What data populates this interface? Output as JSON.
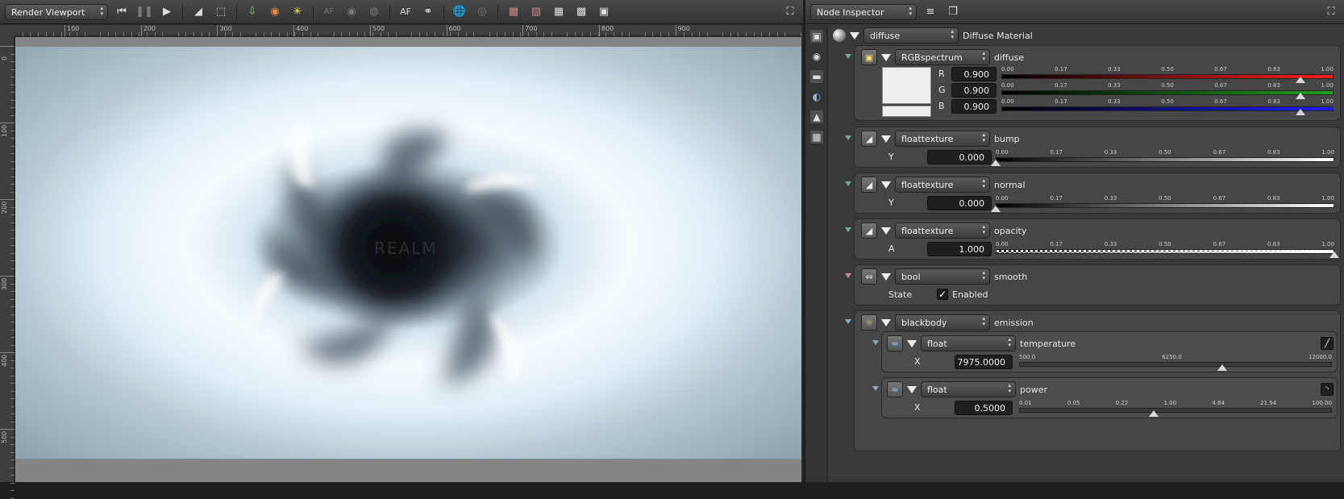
{
  "viewport": {
    "mode_label": "Render Viewport",
    "toolbar_text": {
      "af": "AF",
      "af_dim": "AF"
    },
    "ruler_h": [
      "100",
      "200",
      "300",
      "400",
      "500",
      "600",
      "700",
      "800",
      "900"
    ],
    "ruler_v": [
      "0",
      "100",
      "200",
      "300",
      "400",
      "500"
    ],
    "watermark": "REALM"
  },
  "inspector": {
    "mode_label": "Node Inspector",
    "material": {
      "type": "diffuse",
      "name": "Diffuse Material"
    },
    "diffuse": {
      "texture": "RGBspectrum",
      "param": "diffuse",
      "channels": [
        {
          "label": "R",
          "value": "0.900",
          "fraction": 0.9,
          "color": "#ff1e1e"
        },
        {
          "label": "G",
          "value": "0.900",
          "fraction": 0.9,
          "color": "#1ea01e"
        },
        {
          "label": "B",
          "value": "0.900",
          "fraction": 0.9,
          "color": "#1e1eff"
        }
      ]
    },
    "slider_ticks": [
      "0.00",
      "0.17",
      "0.33",
      "0.50",
      "0.67",
      "0.83",
      "1.00"
    ],
    "bump": {
      "texture": "floattexture",
      "param": "bump",
      "channel": "Y",
      "value": "0.000",
      "fraction": 0.0
    },
    "normal": {
      "texture": "floattexture",
      "param": "normal",
      "channel": "Y",
      "value": "0.000",
      "fraction": 0.0
    },
    "opacity": {
      "texture": "floattexture",
      "param": "opacity",
      "channel": "A",
      "value": "1.000",
      "fraction": 1.0
    },
    "smooth": {
      "texture": "bool",
      "param": "smooth",
      "label": "State",
      "check_label": "Enabled",
      "checked": true
    },
    "emission": {
      "texture": "blackbody",
      "param": "emission",
      "temperature": {
        "texture": "float",
        "param": "temperature",
        "channel": "X",
        "value": "7975.0000",
        "fraction": 0.65,
        "ticks": [
          "500.0",
          "6250.0",
          "12000.0"
        ]
      },
      "power": {
        "texture": "float",
        "param": "power",
        "channel": "X",
        "value": "0.5000",
        "fraction": 0.43,
        "ticks": [
          "0.01",
          "0.05",
          "0.22",
          "1.00",
          "4.64",
          "21.54",
          "100.00"
        ]
      }
    }
  }
}
